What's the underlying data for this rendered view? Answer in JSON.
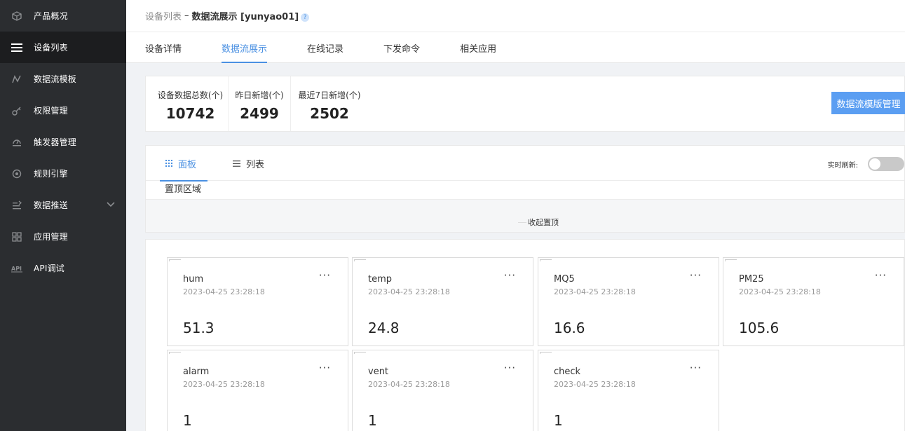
{
  "sidebar": {
    "items": [
      {
        "label": "产品概况",
        "icon": "cube-icon"
      },
      {
        "label": "设备列表",
        "icon": "list-icon",
        "active": true
      },
      {
        "label": "数据流模板",
        "icon": "chart-line-icon"
      },
      {
        "label": "权限管理",
        "icon": "key-icon"
      },
      {
        "label": "触发器管理",
        "icon": "gauge-icon"
      },
      {
        "label": "规则引擎",
        "icon": "target-icon"
      },
      {
        "label": "数据推送",
        "icon": "push-icon"
      },
      {
        "label": "应用管理",
        "icon": "grid-icon"
      },
      {
        "label": "API调试",
        "icon": "api-icon"
      }
    ]
  },
  "breadcrumb": {
    "parent": "设备列表",
    "separator": "–",
    "current": "数据流展示 [yunyao01]",
    "help": "?"
  },
  "tabs": [
    {
      "label": "设备详情"
    },
    {
      "label": "数据流展示",
      "active": true
    },
    {
      "label": "在线记录"
    },
    {
      "label": "下发命令"
    },
    {
      "label": "相关应用"
    }
  ],
  "stats": [
    {
      "label": "设备数据总数(个)",
      "value": "10742"
    },
    {
      "label": "昨日新增(个)",
      "value": "2499"
    },
    {
      "label": "最近7日新增(个)",
      "value": "2502"
    }
  ],
  "manage_button": "数据流模版管理",
  "view_tabs": {
    "panel": "面板",
    "list": "列表"
  },
  "refresh_label": "实时刷新:",
  "pin_area_label": "置顶区域",
  "collapse_label": "收起置顶",
  "more_label": "···",
  "cards": [
    {
      "name": "hum",
      "time": "2023-04-25 23:28:18",
      "value": "51.3"
    },
    {
      "name": "temp",
      "time": "2023-04-25 23:28:18",
      "value": "24.8"
    },
    {
      "name": "MQ5",
      "time": "2023-04-25 23:28:18",
      "value": "16.6"
    },
    {
      "name": "PM25",
      "time": "2023-04-25 23:28:18",
      "value": "105.6"
    },
    {
      "name": "alarm",
      "time": "2023-04-25 23:28:18",
      "value": "1"
    },
    {
      "name": "vent",
      "time": "2023-04-25 23:28:18",
      "value": "1"
    },
    {
      "name": "check",
      "time": "2023-04-25 23:28:18",
      "value": "1"
    }
  ],
  "colors": {
    "sidebar_bg": "#2b2d30",
    "sidebar_active_bg": "#1c1d1f",
    "accent": "#4a90e2",
    "button_bg": "#5b9ef2"
  }
}
